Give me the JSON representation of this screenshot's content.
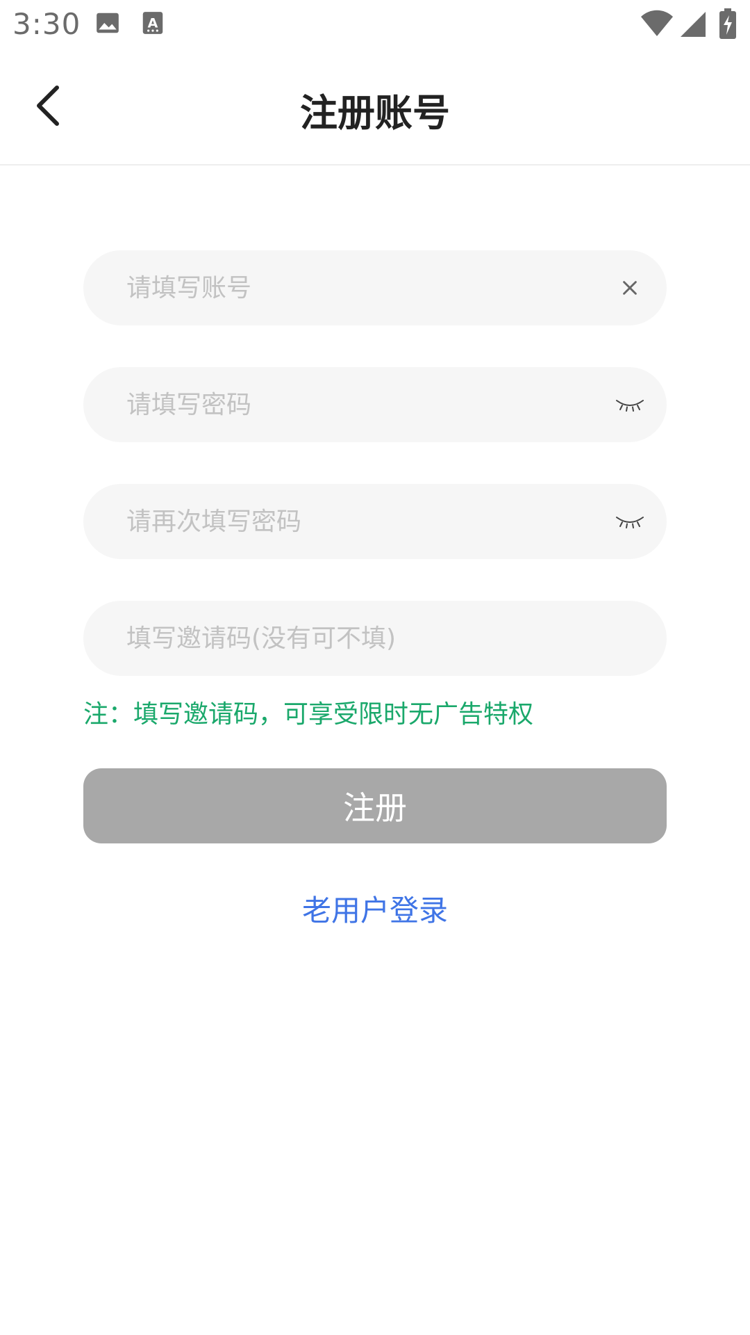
{
  "status_bar": {
    "time": "3:30",
    "icons": [
      "image-icon",
      "text-badge-icon",
      "wifi-icon",
      "signal-icon",
      "battery-charging-icon"
    ]
  },
  "header": {
    "title": "注册账号",
    "back_icon": "chevron-left-icon"
  },
  "form": {
    "account": {
      "placeholder": "请填写账号",
      "value": "",
      "icon": "clear-icon"
    },
    "password": {
      "placeholder": "请填写密码",
      "value": "",
      "icon": "eye-closed-icon"
    },
    "confirm_password": {
      "placeholder": "请再次填写密码",
      "value": "",
      "icon": "eye-closed-icon"
    },
    "invite_code": {
      "placeholder": "填写邀请码(没有可不填)",
      "value": ""
    },
    "note": "注：填写邀请码，可享受限时无广告特权",
    "register_label": "注册",
    "login_link": "老用户登录"
  },
  "colors": {
    "note": "#1aa86b",
    "register_button": "#a8a8a8",
    "link": "#3f74e6",
    "field_bg": "#f6f6f6"
  }
}
